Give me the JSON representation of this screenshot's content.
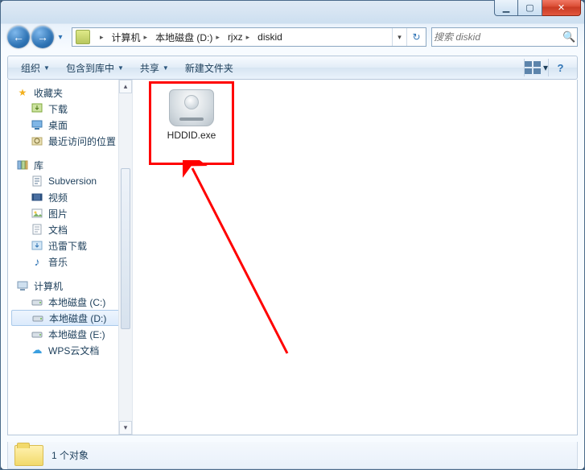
{
  "titlebar": {
    "min_glyph": "▁",
    "max_glyph": "▢",
    "close_glyph": "✕"
  },
  "nav": {
    "back_glyph": "←",
    "fwd_glyph": "→",
    "history_dd": "▾",
    "crumbs": [
      "计算机",
      "本地磁盘 (D:)",
      "rjxz",
      "diskid"
    ],
    "chev": "▸",
    "addr_dd": "▾",
    "refresh": "↻"
  },
  "search": {
    "placeholder": "搜索 diskid",
    "icon": "🔍"
  },
  "toolbar": {
    "organize": "组织",
    "include": "包含到库中",
    "share": "共享",
    "newfolder": "新建文件夹",
    "dd": "▼",
    "view_dd": "▾",
    "help": "?"
  },
  "tree": {
    "favorites": {
      "label": "收藏夹",
      "star": "★"
    },
    "downloads": "下载",
    "desktop": "桌面",
    "recent": "最近访问的位置",
    "libraries": "库",
    "subversion": "Subversion",
    "videos": "视频",
    "pictures": "图片",
    "documents": "文档",
    "xunlei": "迅雷下载",
    "music": "音乐",
    "computer": "计算机",
    "drive_c": "本地磁盘 (C:)",
    "drive_d": "本地磁盘 (D:)",
    "drive_e": "本地磁盘 (E:)",
    "wps": "WPS云文档"
  },
  "content": {
    "files": [
      {
        "name": "HDDID.exe"
      }
    ]
  },
  "status": {
    "text": "1 个对象"
  }
}
